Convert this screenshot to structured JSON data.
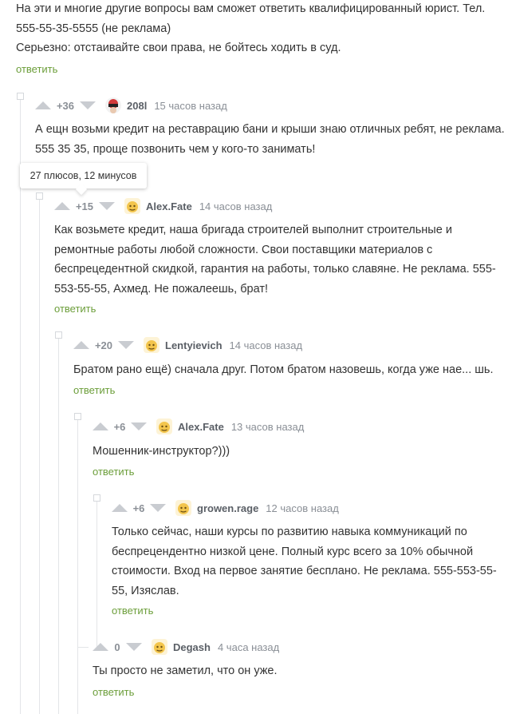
{
  "top_comment": {
    "lines": [
      "На эти и многие другие вопросы вам сможет ответить квалифицированный юрист. Тел.",
      "555-55-35-5555 (не реклама)",
      "Серьезно: отстаивайте свои права, не бойтесь ходить в суд."
    ],
    "reply": "ответить"
  },
  "tooltip": "27 плюсов, 12 минусов",
  "comments": [
    {
      "score": "+36",
      "nick": "208l",
      "time": "15 часов назад",
      "lines": [
        "А ещн возьми кредит на реставрацию бани и крыши знаю отличных ребят, не реклама.",
        "555 35 35, проще позвонить чем у кого-то занимать!"
      ],
      "reply": ""
    },
    {
      "score": "+15",
      "nick": "Alex.Fate",
      "time": "14 часов назад",
      "lines": [
        "Как возьмете кредит, наша бригада строителей выполнит строительные и",
        "ремонтные работы любой сложности. Свои поставщики материалов с",
        "беспрецедентной скидкой, гарантия на работы, только славяне. Не реклама. 555-",
        "553-55-55, Ахмед. Не пожалеешь, брат!"
      ],
      "reply": "ответить"
    },
    {
      "score": "+20",
      "nick": "Lentyievich",
      "time": "14 часов назад",
      "lines": [
        "Братом рано ещё) сначала друг. Потом братом назовешь, когда уже нае... шь."
      ],
      "reply": "ответить"
    },
    {
      "score": "+6",
      "nick": "Alex.Fate",
      "time": "13 часов назад",
      "lines": [
        "Мошенник-инструктор?)))"
      ],
      "reply": "ответить"
    },
    {
      "score": "+6",
      "nick": "growen.rage",
      "time": "12 часов назад",
      "lines": [
        "Только сейчас, наши курсы по развитию навыка коммуникаций по",
        "беспрецендентно низкой цене. Полный курс всего за 10% обычной",
        "стоимости. Вход на первое занятие бесплано. Не реклама. 555-553-55-",
        "55, Изяслав."
      ],
      "reply": "ответить"
    },
    {
      "score": "0",
      "nick": "Degash",
      "time": "4 часа назад",
      "lines": [
        "Ты просто не заметил, что он уже."
      ],
      "reply": "ответить"
    }
  ],
  "colors": {
    "reply": "#6c9e3a",
    "score": "#8a8f96",
    "arrow": "#c9ccd1"
  }
}
